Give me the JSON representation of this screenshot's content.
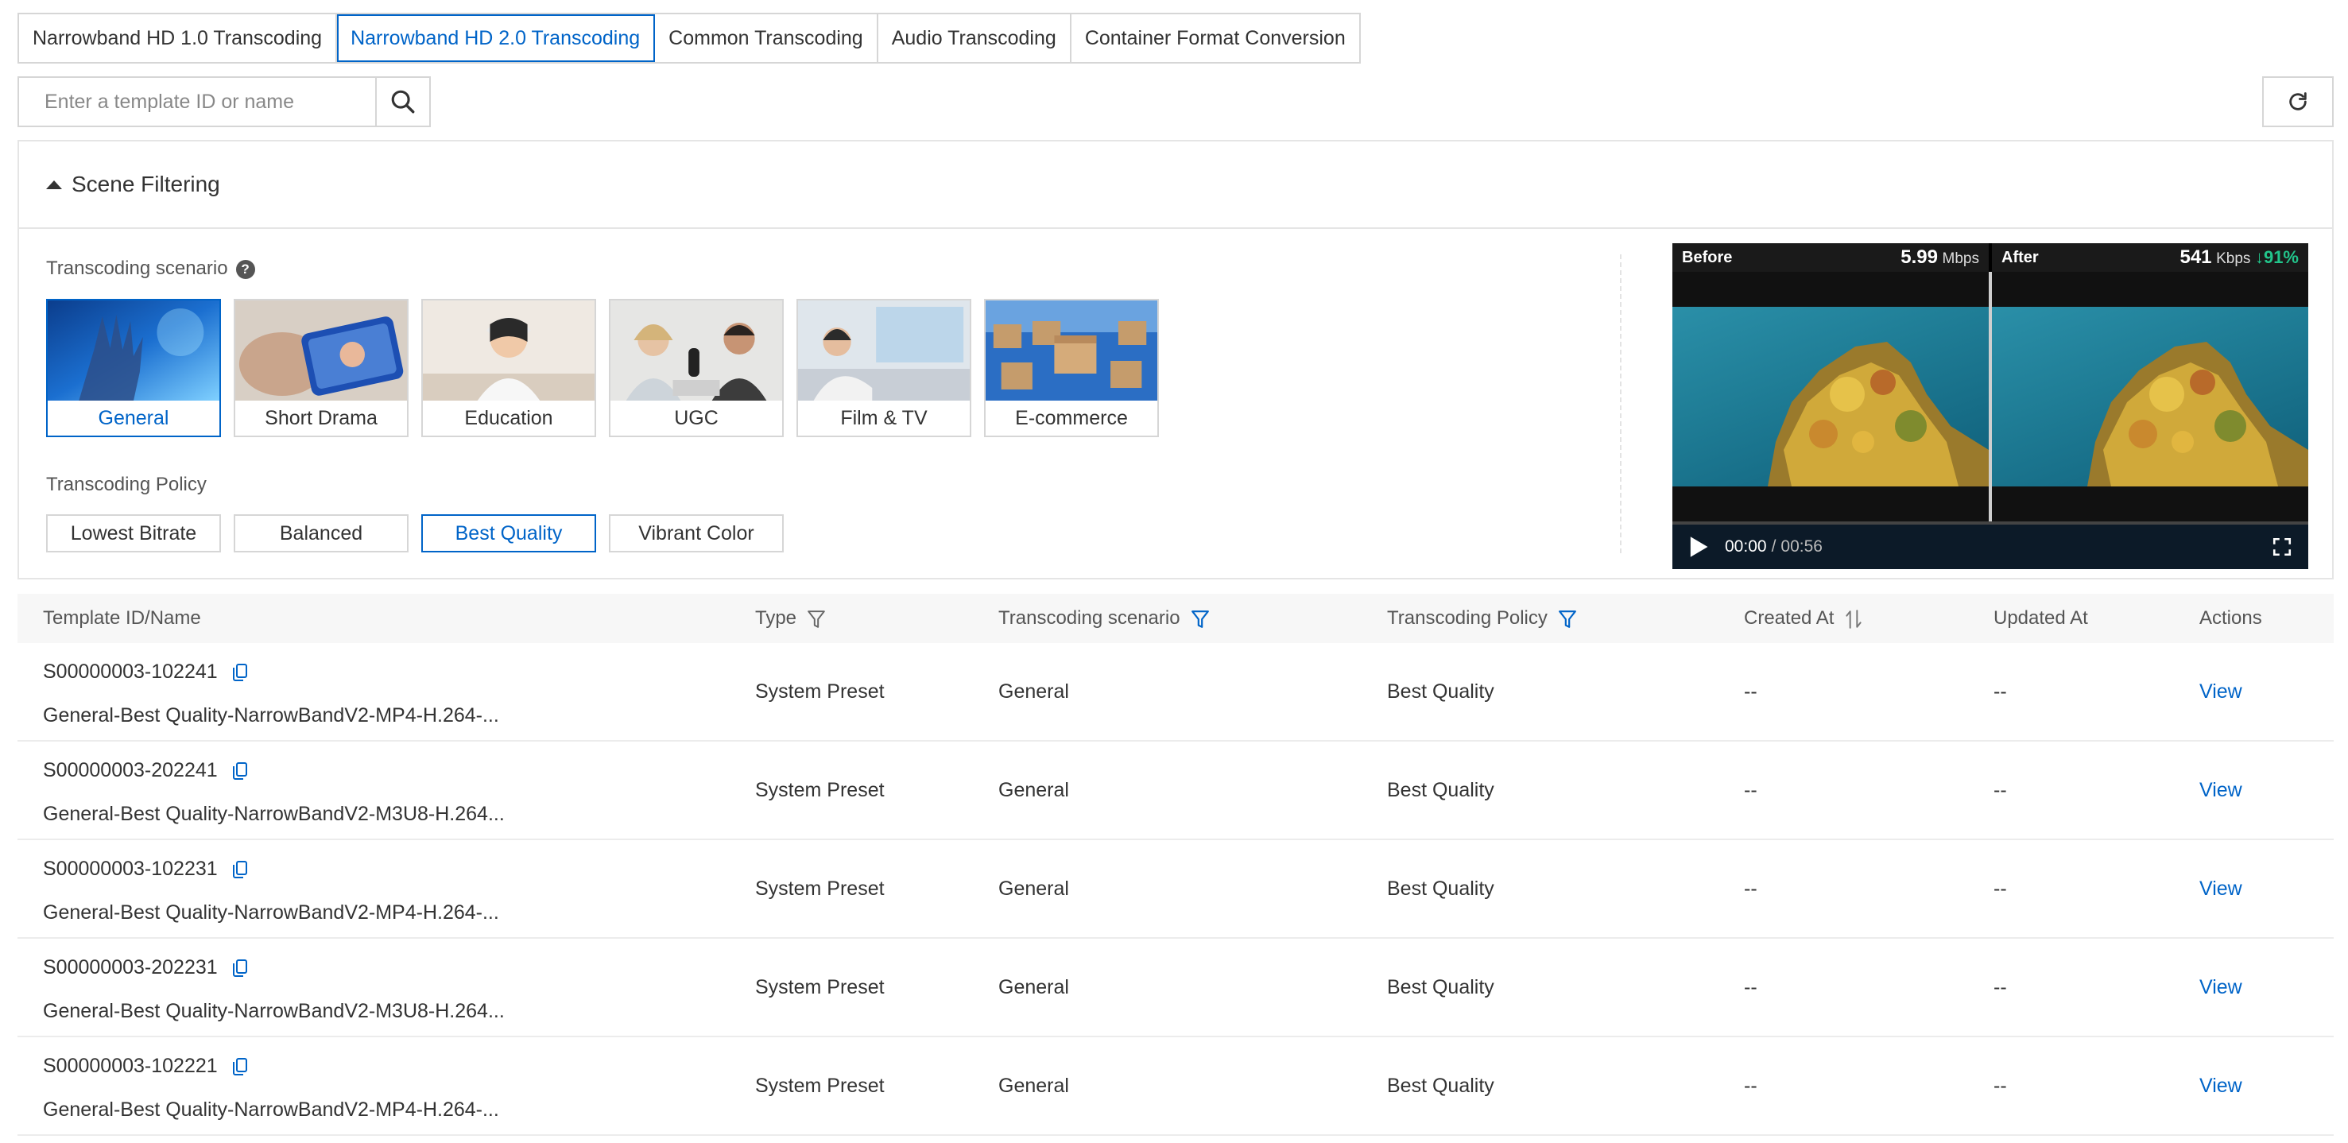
{
  "tabs": [
    {
      "label": "Narrowband HD 1.0 Transcoding",
      "active": false
    },
    {
      "label": "Narrowband HD 2.0 Transcoding",
      "active": true
    },
    {
      "label": "Common Transcoding",
      "active": false
    },
    {
      "label": "Audio Transcoding",
      "active": false
    },
    {
      "label": "Container Format Conversion",
      "active": false
    }
  ],
  "search": {
    "placeholder": "Enter a template ID or name",
    "value": ""
  },
  "scene_filter": {
    "title": "Scene Filtering",
    "scenario_label": "Transcoding scenario",
    "scenarios": [
      {
        "label": "General",
        "selected": true
      },
      {
        "label": "Short Drama",
        "selected": false
      },
      {
        "label": "Education",
        "selected": false
      },
      {
        "label": "UGC",
        "selected": false
      },
      {
        "label": "Film & TV",
        "selected": false
      },
      {
        "label": "E-commerce",
        "selected": false
      }
    ],
    "policy_label": "Transcoding Policy",
    "policies": [
      {
        "label": "Lowest Bitrate",
        "selected": false
      },
      {
        "label": "Balanced",
        "selected": false
      },
      {
        "label": "Best Quality",
        "selected": true
      },
      {
        "label": "Vibrant Color",
        "selected": false
      }
    ]
  },
  "preview": {
    "before_label": "Before",
    "before_bitrate": "5.99",
    "before_unit": "Mbps",
    "after_label": "After",
    "after_bitrate": "541",
    "after_unit": "Kbps",
    "reduction": "↓91%",
    "time_current": "00:00",
    "time_separator": "/",
    "time_total": "00:56"
  },
  "table": {
    "headers": {
      "id_name": "Template ID/Name",
      "type": "Type",
      "scenario": "Transcoding scenario",
      "policy": "Transcoding Policy",
      "created": "Created At",
      "updated": "Updated At",
      "actions": "Actions"
    },
    "rows": [
      {
        "id": "S00000003-102241",
        "name": "General-Best Quality-NarrowBandV2-MP4-H.264-...",
        "type": "System Preset",
        "scenario": "General",
        "policy": "Best Quality",
        "created": "--",
        "updated": "--",
        "action": "View"
      },
      {
        "id": "S00000003-202241",
        "name": "General-Best Quality-NarrowBandV2-M3U8-H.264...",
        "type": "System Preset",
        "scenario": "General",
        "policy": "Best Quality",
        "created": "--",
        "updated": "--",
        "action": "View"
      },
      {
        "id": "S00000003-102231",
        "name": "General-Best Quality-NarrowBandV2-MP4-H.264-...",
        "type": "System Preset",
        "scenario": "General",
        "policy": "Best Quality",
        "created": "--",
        "updated": "--",
        "action": "View"
      },
      {
        "id": "S00000003-202231",
        "name": "General-Best Quality-NarrowBandV2-M3U8-H.264...",
        "type": "System Preset",
        "scenario": "General",
        "policy": "Best Quality",
        "created": "--",
        "updated": "--",
        "action": "View"
      },
      {
        "id": "S00000003-102221",
        "name": "General-Best Quality-NarrowBandV2-MP4-H.264-...",
        "type": "System Preset",
        "scenario": "General",
        "policy": "Best Quality",
        "created": "--",
        "updated": "--",
        "action": "View"
      }
    ]
  },
  "colors": {
    "accent": "#0064c8",
    "border": "#d6d6d6",
    "success": "#22c58b"
  }
}
